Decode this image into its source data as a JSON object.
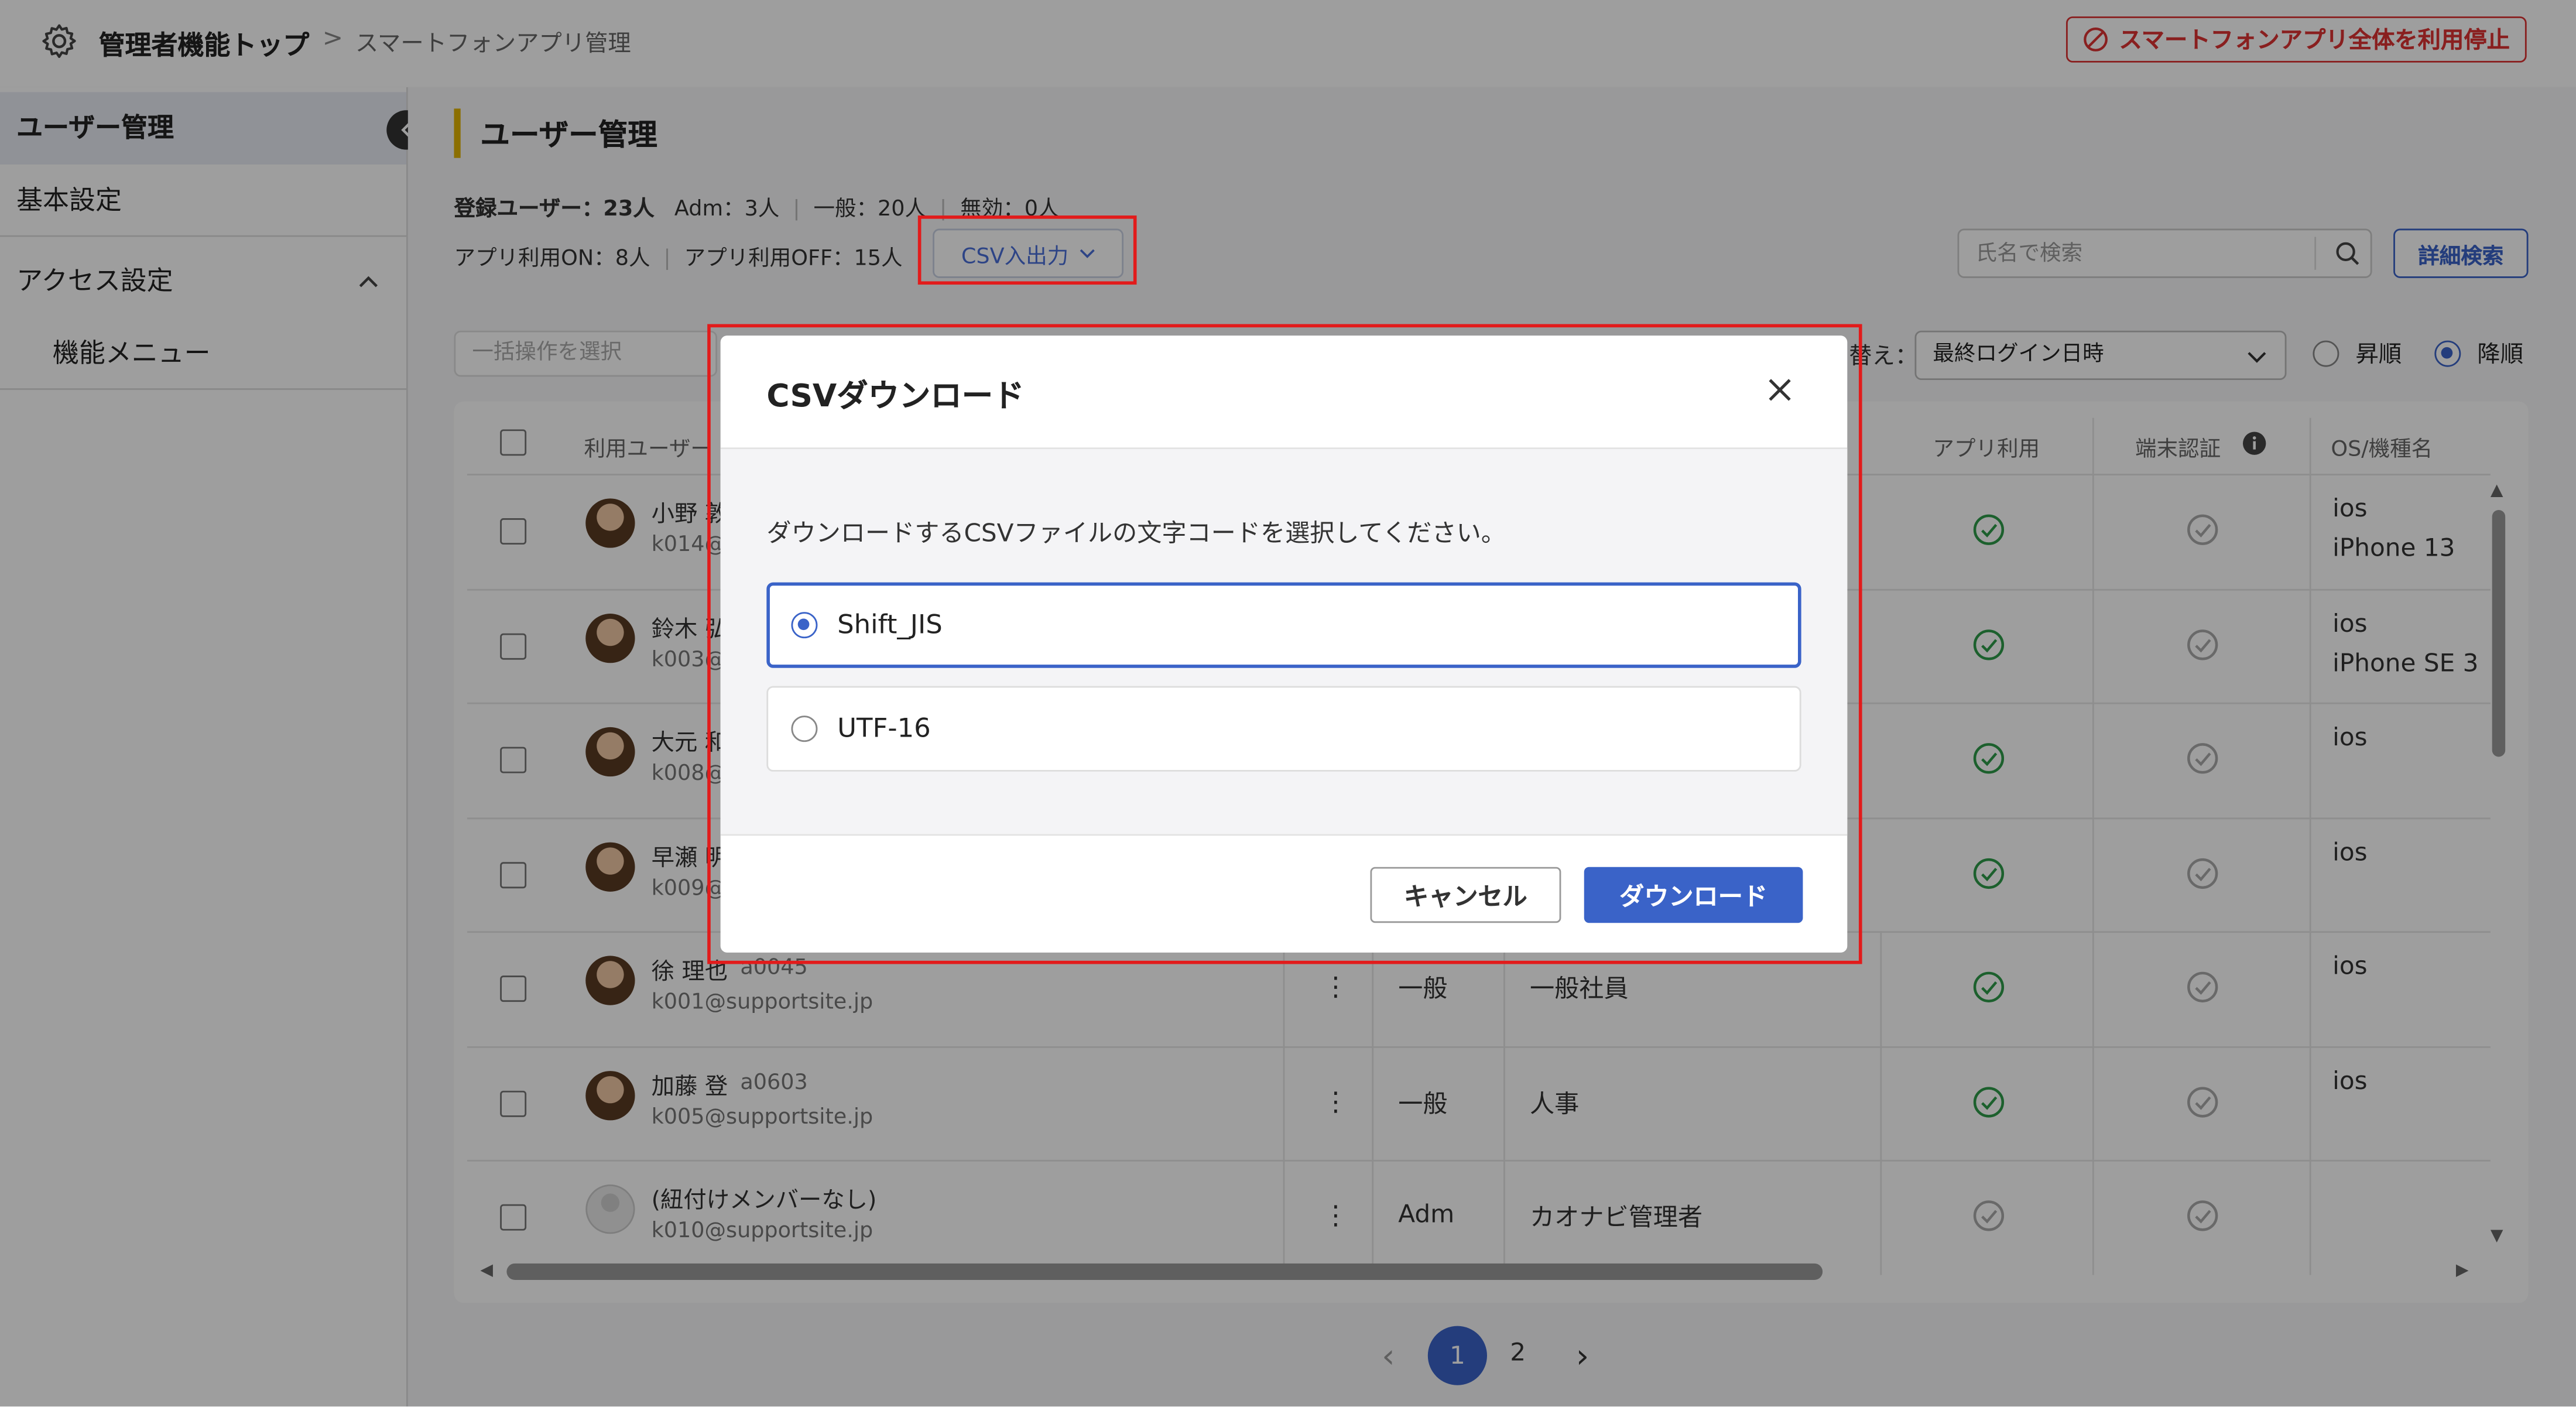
{
  "header": {
    "breadcrumb_top": "管理者機能トップ",
    "breadcrumb_sep": ">",
    "breadcrumb_current": "スマートフォンアプリ管理",
    "stop_button_label": "スマートフォンアプリ全体を利用停止"
  },
  "sidebar": {
    "items": [
      {
        "label": "ユーザー管理"
      },
      {
        "label": "基本設定"
      },
      {
        "label": "アクセス設定"
      },
      {
        "label": "機能メニュー"
      }
    ]
  },
  "main": {
    "title": "ユーザー管理",
    "stats": {
      "registered_label": "登録ユーザー：23人",
      "adm": "Adm：3人",
      "general": "一般：20人",
      "invalid": "無効：0人",
      "app_on": "アプリ利用ON：8人",
      "app_off": "アプリ利用OFF：15人"
    },
    "csv_button_label": "CSV入出力",
    "search_placeholder": "氏名で検索",
    "advanced_search_label": "詳細検索",
    "bulk_placeholder": "一括操作を選択",
    "sort_label": "替え：",
    "sort_value": "最終ログイン日時",
    "asc_label": "昇順",
    "desc_label": "降順",
    "desc_selected": true
  },
  "table": {
    "headers": [
      "利用ユーザー",
      "アプリ利用",
      "端末認証",
      "OS/機種名"
    ],
    "rows": [
      {
        "name": "小野 敦",
        "email": "k014@",
        "os": "ios",
        "model": "iPhone 13",
        "role": "",
        "dept": "",
        "app": true
      },
      {
        "name": "鈴木 弘",
        "email": "k003@",
        "os": "ios",
        "model": "iPhone SE 3",
        "role": "",
        "dept": "",
        "app": true
      },
      {
        "name": "大元 和",
        "email": "k008@",
        "os": "ios",
        "model": "",
        "role": "",
        "dept": "",
        "app": true
      },
      {
        "name": "早瀬 明",
        "email": "k009@",
        "os": "ios",
        "model": "",
        "role": "",
        "dept": "",
        "app": true
      },
      {
        "name": "徐 理也",
        "code": "a0045",
        "email": "k001@supportsite.jp",
        "os": "ios",
        "model": "",
        "role": "一般",
        "dept": "一般社員",
        "app": true
      },
      {
        "name": "加藤 登",
        "code": "a0603",
        "email": "k005@supportsite.jp",
        "os": "ios",
        "model": "",
        "role": "一般",
        "dept": "人事",
        "app": true
      },
      {
        "name": "(紐付けメンバーなし)",
        "email": "k010@supportsite.jp",
        "os": "",
        "model": "",
        "role": "Adm",
        "dept": "カオナビ管理者",
        "app": false
      }
    ]
  },
  "pagination": {
    "prev": "‹",
    "pages": [
      "1",
      "2"
    ],
    "current": "1",
    "next": "›"
  },
  "dialog": {
    "title": "CSVダウンロード",
    "message": "ダウンロードするCSVファイルの文字コードを選択してください。",
    "options": [
      {
        "label": "Shift_JIS",
        "selected": true
      },
      {
        "label": "UTF-16",
        "selected": false
      }
    ],
    "cancel_label": "キャンセル",
    "download_label": "ダウンロード"
  },
  "colors": {
    "accent": "#3a63c8",
    "danger": "#d33333",
    "highlight": "#e21b1b",
    "success": "#2e9b4a"
  }
}
